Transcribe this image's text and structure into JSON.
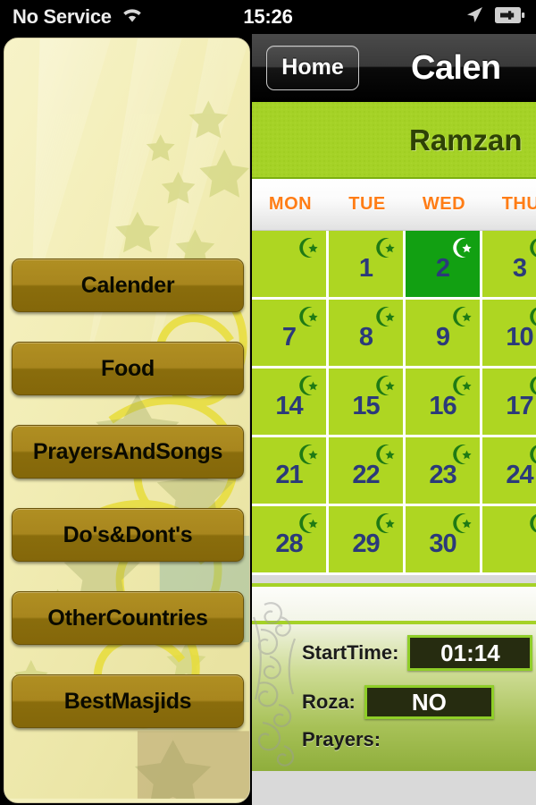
{
  "statusbar": {
    "carrier": "No Service",
    "time": "15:26",
    "wifi_icon": "wifi-icon",
    "location_icon": "location-arrow-icon",
    "battery_icon": "battery-charging-icon"
  },
  "navbar": {
    "back_label": "Home",
    "title": "Calen"
  },
  "sidebar": {
    "items": [
      {
        "label": "Calender"
      },
      {
        "label": "Food"
      },
      {
        "label": "PrayersAndSongs"
      },
      {
        "label": "Do's&Dont's"
      },
      {
        "label": "OtherCountries"
      },
      {
        "label": "BestMasjids"
      }
    ]
  },
  "calendar": {
    "banner_title": "Ramzan",
    "day_headers": [
      "MON",
      "TUE",
      "WED",
      "THU"
    ],
    "rows": [
      [
        {
          "num": "",
          "selected": false
        },
        {
          "num": "1",
          "selected": false
        },
        {
          "num": "2",
          "selected": true
        },
        {
          "num": "3",
          "selected": false
        }
      ],
      [
        {
          "num": "7",
          "selected": false
        },
        {
          "num": "8",
          "selected": false
        },
        {
          "num": "9",
          "selected": false
        },
        {
          "num": "10",
          "selected": false
        }
      ],
      [
        {
          "num": "14",
          "selected": false
        },
        {
          "num": "15",
          "selected": false
        },
        {
          "num": "16",
          "selected": false
        },
        {
          "num": "17",
          "selected": false
        }
      ],
      [
        {
          "num": "21",
          "selected": false
        },
        {
          "num": "22",
          "selected": false
        },
        {
          "num": "23",
          "selected": false
        },
        {
          "num": "24",
          "selected": false
        }
      ],
      [
        {
          "num": "28",
          "selected": false
        },
        {
          "num": "29",
          "selected": false
        },
        {
          "num": "30",
          "selected": false
        },
        {
          "num": "",
          "selected": false
        }
      ]
    ],
    "cell_icon": "crescent-star-icon"
  },
  "info": {
    "start_time_label": "StartTime:",
    "start_time_value": "01:14",
    "roza_label": "Roza:",
    "roza_value": "NO",
    "prayers_label": "Prayers:"
  },
  "colors": {
    "cell_green": "#aed622",
    "selected_green": "#12a012",
    "banner_green": "#a5d227",
    "day_header_orange": "#ff7d16",
    "number_navy": "#2b3a7a",
    "button_gold": "#a8861e",
    "value_box_bg": "#262c10",
    "value_box_border": "#8fce28"
  }
}
